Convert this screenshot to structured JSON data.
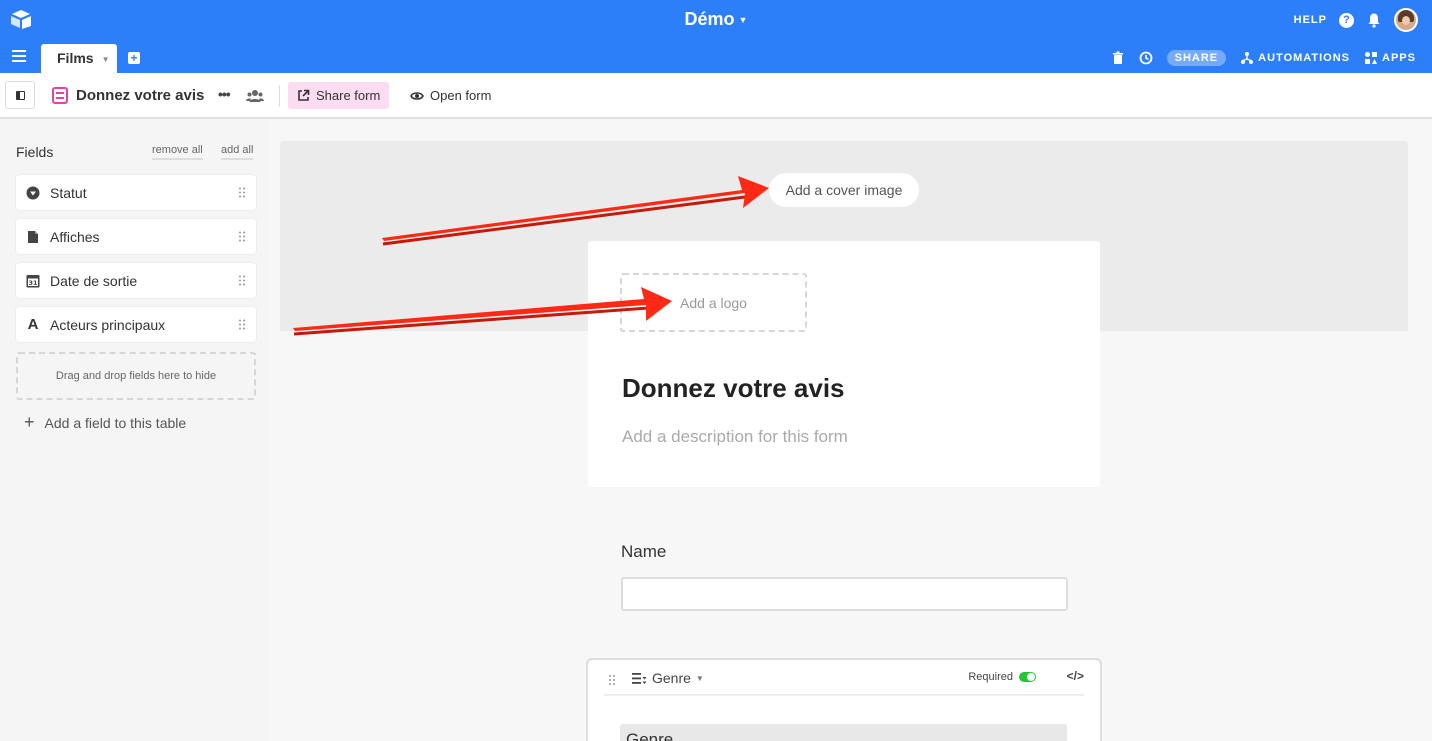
{
  "header": {
    "base_title": "Démo",
    "help_label": "HELP",
    "help_icon": "?",
    "tabs": [
      {
        "label": "Films",
        "active": true
      }
    ],
    "toolbar": {
      "share_label": "SHARE",
      "automations_label": "AUTOMATIONS",
      "apps_label": "APPS"
    }
  },
  "viewbar": {
    "view_name": "Donnez votre avis",
    "more_label": "•••",
    "share_form_label": "Share form",
    "open_form_label": "Open form"
  },
  "sidebar": {
    "heading": "Fields",
    "remove_all": "remove all",
    "add_all": "add all",
    "fields": [
      {
        "label": "Statut",
        "icon": "dropdown-circle-icon"
      },
      {
        "label": "Affiches",
        "icon": "file-icon"
      },
      {
        "label": "Date de sortie",
        "icon": "calendar-icon",
        "icon_text": "31"
      },
      {
        "label": "Acteurs principaux",
        "icon": "text-icon",
        "icon_text": "A"
      }
    ],
    "drop_hint": "Drag and drop fields here to hide",
    "add_field": "Add a field to this table"
  },
  "form": {
    "cover_button": "Add a cover image",
    "logo_button": "Add a logo",
    "title": "Donnez votre avis",
    "description_placeholder": "Add a description for this form",
    "questions": [
      {
        "label": "Name",
        "value": ""
      },
      {
        "label": "Genre",
        "type_label": "Genre",
        "required_label": "Required",
        "required": true
      }
    ]
  },
  "colors": {
    "topbar": "#2d7ff9",
    "share_form_bg": "#fbdcf0",
    "form_icon": "#e045a5",
    "toggle_on": "#20c933",
    "arrow": "#ff2a16"
  }
}
